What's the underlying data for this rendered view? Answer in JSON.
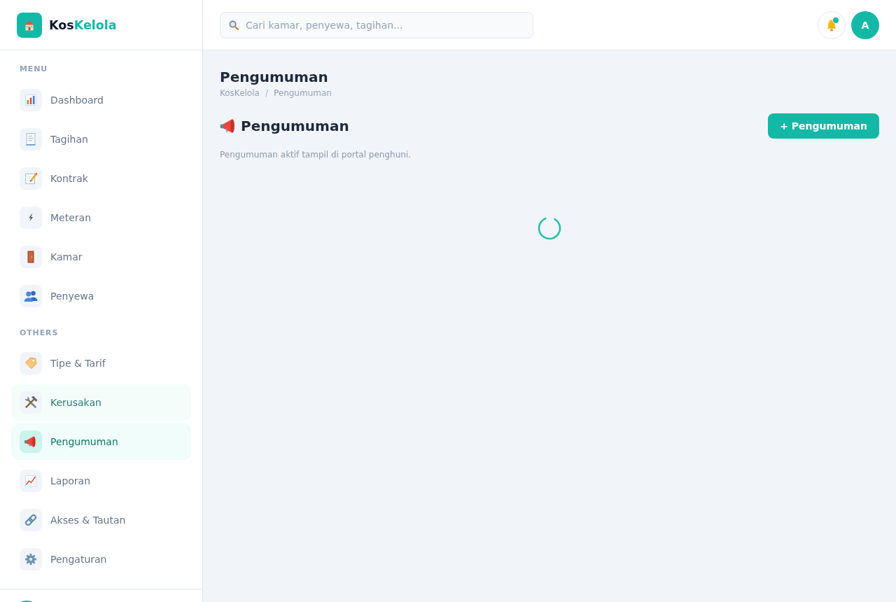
{
  "sidebar": {
    "brand": {
      "parts": [
        "Kos",
        "Kelola"
      ]
    },
    "sections": [
      {
        "label": "MENU",
        "items": [
          {
            "label": "Dashboard",
            "selected": false,
            "highlighted": false
          },
          {
            "label": "Tagihan",
            "selected": false,
            "highlighted": false
          },
          {
            "label": "Kontrak",
            "selected": false,
            "highlighted": false
          },
          {
            "label": "Meteran",
            "selected": false,
            "highlighted": false
          },
          {
            "label": "Kamar",
            "selected": false,
            "highlighted": false
          },
          {
            "label": "Penyewa",
            "selected": false,
            "highlighted": false
          }
        ]
      },
      {
        "label": "OTHERS",
        "items": [
          {
            "label": "Tipe & Tarif",
            "selected": false,
            "highlighted": false
          },
          {
            "label": "Kerusakan",
            "selected": false,
            "highlighted": true
          },
          {
            "label": "Pengumuman",
            "selected": true,
            "highlighted": false
          },
          {
            "label": "Laporan",
            "selected": false,
            "highlighted": false
          },
          {
            "label": "Akses & Tautan",
            "selected": false,
            "highlighted": false
          },
          {
            "label": "Pengaturan",
            "selected": false,
            "highlighted": false
          }
        ]
      }
    ]
  },
  "topbar": {
    "search": {
      "placeholder": "Cari kamar, penyewa, tagihan..."
    },
    "notifications": {
      "unread": true
    },
    "avatar": {
      "initial": "A"
    }
  },
  "page": {
    "title": "Pengumuman",
    "breadcrumb": {
      "items": [
        "KosKelola",
        "Pengumuman"
      ],
      "separator": "/"
    },
    "section": {
      "title": "Pengumuman",
      "add_button": "+ Pengumuman",
      "description": "Pengumuman aktif tampil di portal penghuni."
    },
    "loading": true
  }
}
